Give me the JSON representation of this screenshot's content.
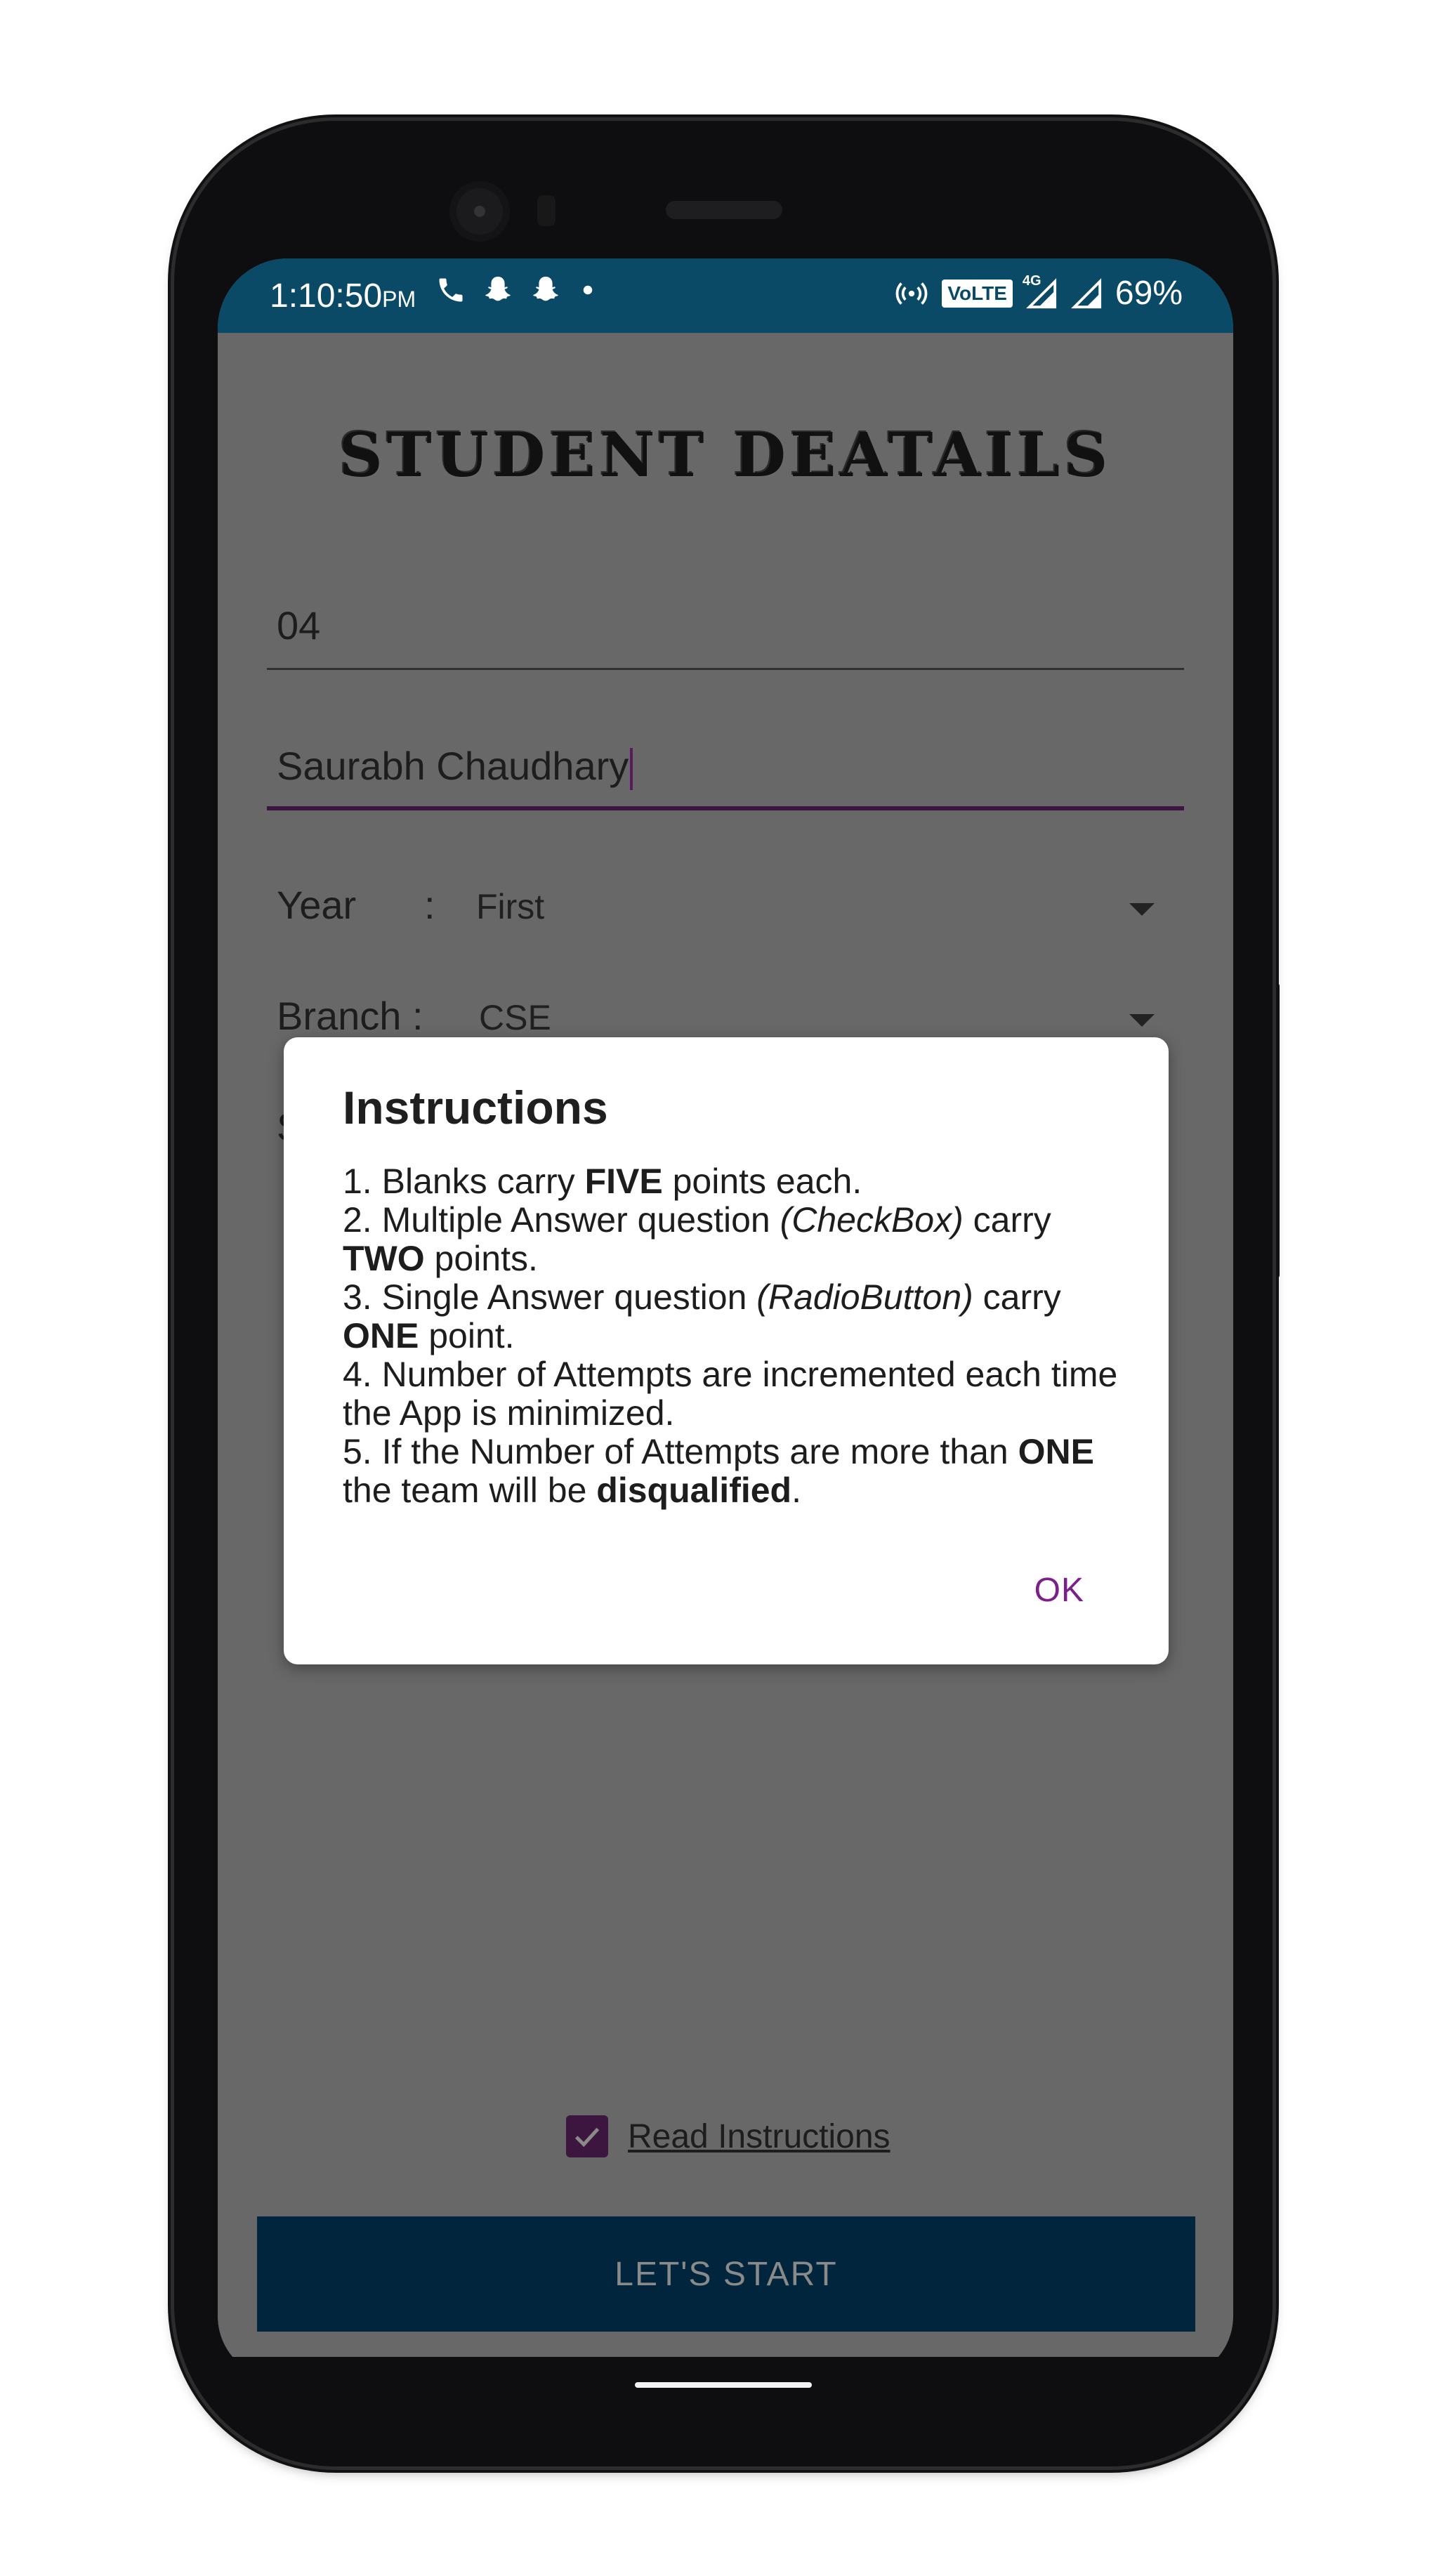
{
  "status_bar": {
    "time": "1:10:50",
    "ampm": "PM",
    "left_icons": [
      "phone-icon",
      "snapchat-icon",
      "snapchat-icon",
      "dot-icon"
    ],
    "right_icons": [
      "hotspot-icon",
      "volte-badge",
      "signal-4g-icon",
      "signal-icon"
    ],
    "volte": "VoLTE",
    "network": "4G",
    "battery": "69%",
    "color": "#0a4a66"
  },
  "form": {
    "title": "STUDENT DEATAILS",
    "roll_value": "04",
    "name_value": "Saurabh Chaudhary",
    "year_label": "Year",
    "year_colon": ":",
    "year_value": "First",
    "branch_label": "Branch",
    "branch_colon": ":",
    "branch_value": "CSE",
    "third_row_stub": "S"
  },
  "dialog": {
    "title": "Instructions",
    "items": [
      {
        "num": " 1.",
        "parts": [
          "Blanks carry ",
          "FIVE",
          " points each."
        ]
      },
      {
        "num": " 2.",
        "parts": [
          "Multiple Answer question ",
          "(CheckBox)",
          " carry ",
          "TWO",
          " points."
        ]
      },
      {
        "num": " 3.",
        "parts": [
          "Single Answer question ",
          "(RadioButton)",
          " carry ",
          "ONE",
          " point."
        ]
      },
      {
        "num": " 4.",
        "parts": [
          "Number of Attempts are incremented each time the App is minimized."
        ]
      },
      {
        "num": " 5.",
        "parts": [
          "If the Number of Attempts are more than ",
          "ONE",
          " the team will be ",
          "disqualified",
          "."
        ]
      }
    ],
    "ok_label": "OK",
    "ok_color": "#7b1f8a"
  },
  "footer": {
    "checkbox_checked": true,
    "checkbox_label": "Read Instructions",
    "checkbox_color": "#3c163f",
    "start_label": "LET'S START",
    "start_color": "#00253d"
  }
}
